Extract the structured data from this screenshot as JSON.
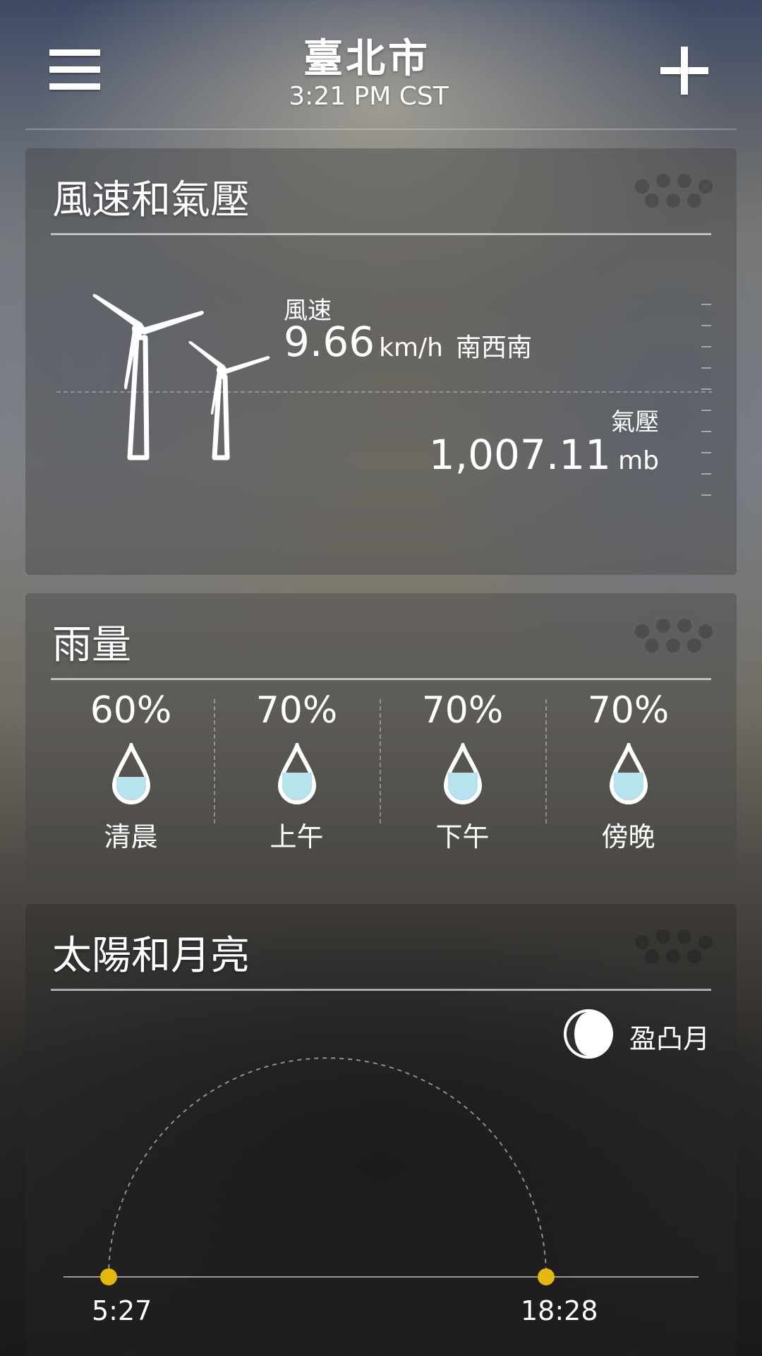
{
  "header": {
    "city": "臺北市",
    "time": "3:21 PM CST",
    "menu_icon": "hamburger-menu-icon",
    "add_icon": "plus-icon"
  },
  "wind_card": {
    "title": "風速和氣壓",
    "wind_label": "風速",
    "wind_speed": "9.66",
    "wind_unit": "km/h",
    "wind_direction": "南西南",
    "pressure_label": "氣壓",
    "pressure_value": "1,007.11",
    "pressure_unit": "mb"
  },
  "rain_card": {
    "title": "雨量",
    "periods": [
      {
        "percent": "60%",
        "label": "清晨",
        "level": 0.6
      },
      {
        "percent": "70%",
        "label": "上午",
        "level": 0.7
      },
      {
        "percent": "70%",
        "label": "下午",
        "level": 0.7
      },
      {
        "percent": "70%",
        "label": "傍晚",
        "level": 0.7
      }
    ]
  },
  "sun_moon_card": {
    "title": "太陽和月亮",
    "moon_phase": "盈凸月",
    "sunrise": "5:27",
    "sunset": "18:28"
  },
  "colors": {
    "sun_dot": "#e2b80c",
    "rain_fill": "#b7e3ef"
  }
}
